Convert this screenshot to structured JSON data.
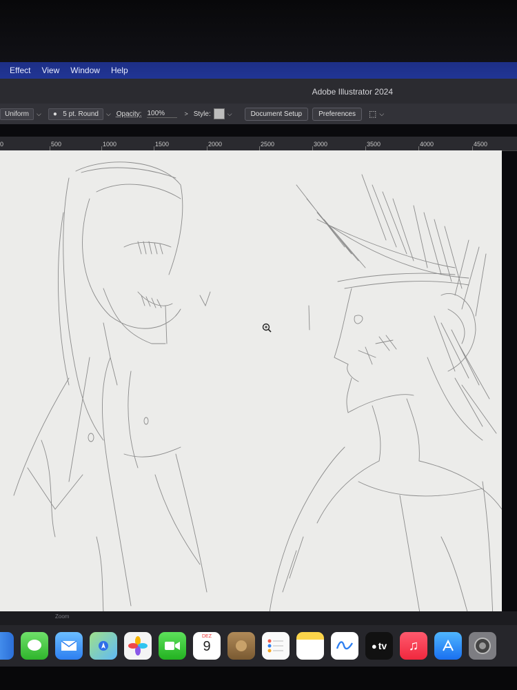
{
  "menu": {
    "items": [
      "Effect",
      "View",
      "Window",
      "Help"
    ]
  },
  "window": {
    "title": "Adobe Illustrator 2024"
  },
  "control_bar": {
    "stroke_profile": "Uniform",
    "brush": "5 pt. Round",
    "opacity_label": "Opacity:",
    "opacity_value": "100%",
    "style_label": "Style:",
    "document_setup": "Document Setup",
    "preferences": "Preferences"
  },
  "ruler": {
    "ticks": [
      "0",
      "500",
      "1000",
      "1500",
      "2000",
      "2500",
      "3000",
      "3500",
      "4000",
      "4500"
    ]
  },
  "status": {
    "zoom_label": "Zoom"
  },
  "dock": {
    "calendar_month": "DEZ",
    "calendar_day": "9",
    "tv_label": "tv",
    "icons": [
      "finder-icon",
      "messages-icon",
      "mail-icon",
      "maps-icon",
      "photos-icon",
      "facetime-icon",
      "calendar-icon",
      "notes-app-icon",
      "reminders-icon",
      "notes-icon",
      "freeform-icon",
      "apple-tv-icon",
      "music-icon",
      "app-store-icon",
      "system-settings-icon"
    ]
  }
}
